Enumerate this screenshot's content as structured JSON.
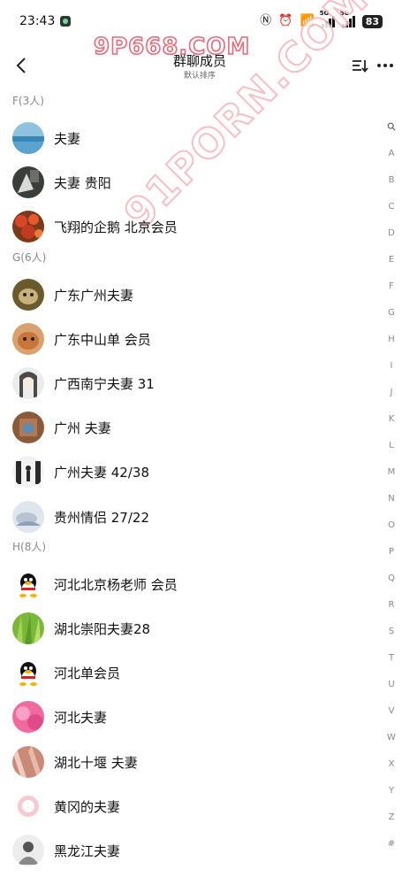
{
  "status_bar": {
    "time": "23:43",
    "battery": "83",
    "signal_tag": "5G"
  },
  "header": {
    "title": "群聊成员",
    "subtitle": "默认排序",
    "watermark": "9P668.COM"
  },
  "watermark_diagonal": "91PORN.COM",
  "sections": [
    {
      "label": "F(3人)",
      "members": [
        {
          "name": "夫妻",
          "avatar": "ocean-photo"
        },
        {
          "name": "夫妻  贵阳",
          "avatar": "dark-photo"
        },
        {
          "name": "飞翔的企鹅  北京会员",
          "avatar": "red-flowers-photo"
        }
      ]
    },
    {
      "label": "G(6人)",
      "members": [
        {
          "name": "广东广州夫妻",
          "avatar": "pet-photo"
        },
        {
          "name": "广东中山单  会员",
          "avatar": "dog-photo"
        },
        {
          "name": "广西南宁夫妻 31",
          "avatar": "portrait-drawing"
        },
        {
          "name": "广州 夫妻",
          "avatar": "brown-photo"
        },
        {
          "name": "广州夫妻  42/38",
          "avatar": "silhouette-photo"
        },
        {
          "name": "贵州情侣 27/22",
          "avatar": "light-photo"
        }
      ]
    },
    {
      "label": "H(8人)",
      "members": [
        {
          "name": "河北北京杨老师 会员",
          "avatar": "qq-penguin"
        },
        {
          "name": "湖北崇阳夫妻28",
          "avatar": "green-grass-photo"
        },
        {
          "name": "河北单会员",
          "avatar": "qq-penguin"
        },
        {
          "name": "河北夫妻",
          "avatar": "pink-photo"
        },
        {
          "name": "湖北十堰 夫妻",
          "avatar": "skin-photo"
        },
        {
          "name": "黄冈的夫妻",
          "avatar": "pink-outline-avatar"
        },
        {
          "name": "黑龙江夫妻",
          "avatar": "sketch-avatar"
        }
      ]
    }
  ],
  "index_letters": [
    "A",
    "B",
    "C",
    "D",
    "E",
    "F",
    "G",
    "H",
    "I",
    "J",
    "K",
    "L",
    "M",
    "N",
    "O",
    "P",
    "Q",
    "R",
    "S",
    "T",
    "U",
    "V",
    "W",
    "X",
    "Y",
    "Z",
    "#"
  ],
  "colors": {
    "watermark_red": "#e86a7a",
    "watermark_pink": "#f4b5bd",
    "section_gray": "#888888"
  }
}
